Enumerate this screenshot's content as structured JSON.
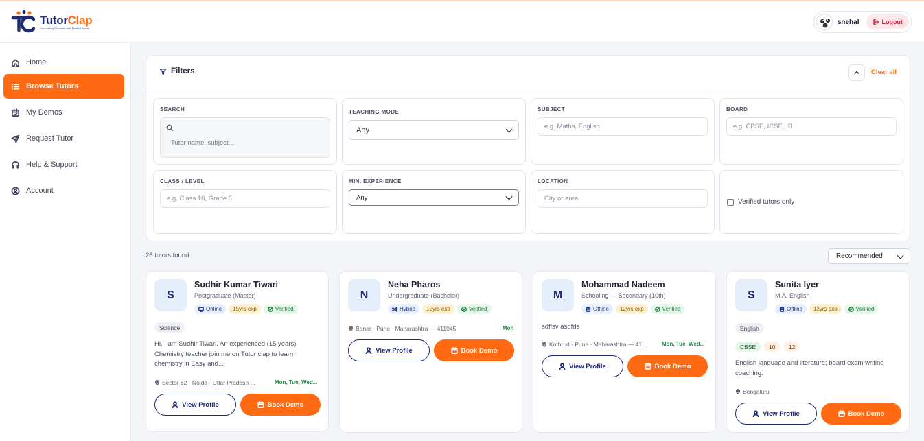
{
  "app": {
    "logo_primary": "Tutor",
    "logo_accent": "Clap",
    "tagline": "Connecting Students with Trusted Tutors"
  },
  "user": {
    "name": "snehal",
    "logout_label": "Logout"
  },
  "nav": [
    {
      "label": "Home",
      "icon": "home-icon"
    },
    {
      "label": "Browse Tutors",
      "icon": "list-icon"
    },
    {
      "label": "My Demos",
      "icon": "calendar-check-icon"
    },
    {
      "label": "Request Tutor",
      "icon": "send-icon"
    },
    {
      "label": "Help & Support",
      "icon": "headset-icon"
    },
    {
      "label": "Account",
      "icon": "user-circle-icon"
    }
  ],
  "filters": {
    "title": "Filters",
    "clear_all": "Clear all",
    "search": {
      "label": "SEARCH",
      "placeholder": "Tutor name, subject..."
    },
    "teaching_mode": {
      "label": "TEACHING MODE",
      "value": "Any"
    },
    "subject": {
      "label": "SUBJECT",
      "placeholder": "e.g. Maths, English"
    },
    "board": {
      "label": "BOARD",
      "placeholder": "e.g. CBSE, ICSE, IB"
    },
    "class_level": {
      "label": "CLASS / LEVEL",
      "placeholder": "e.g. Class 10, Grade 5"
    },
    "min_experience": {
      "label": "MIN. EXPERIENCE",
      "value": "Any"
    },
    "location": {
      "label": "LOCATION",
      "placeholder": "City or area"
    },
    "verified_only": {
      "label": "Verified tutors only",
      "checked": false
    }
  },
  "results": {
    "count_text": "26 tutors found",
    "sort": "Recommended"
  },
  "tutors": [
    {
      "initial": "S",
      "name": "Sudhir Kumar Tiwari",
      "education": "Postgraduate (Master)",
      "mode": "Online",
      "experience": "15yrs exp",
      "verified": "Verified",
      "subjects": [
        "Science"
      ],
      "chips": [],
      "description": "Hi, I am Sudhir Tiwari. An experienced (15 years) Chemistry teacher join me on Tutor clap to learn chemistry in Easy and...",
      "location": "Sector 62 · Noida · Uttar Pradesh ...",
      "days": "Mon, Tue, Wed...",
      "view_label": "View Profile",
      "book_label": "Book Demo"
    },
    {
      "initial": "N",
      "name": "Neha Pharos",
      "education": "Undergraduate (Bachelor)",
      "mode": "Hybrid",
      "experience": "12yrs exp",
      "verified": "Verified",
      "subjects": [],
      "chips": [],
      "description": "",
      "location": "Baner · Pune · Maharashtra — 411045",
      "days": "Mon",
      "view_label": "View Profile",
      "book_label": "Book Demo"
    },
    {
      "initial": "M",
      "name": "Mohammad Nadeem",
      "education": "Schooling — Secondary (10th)",
      "mode": "Offline",
      "experience": "12yrs exp",
      "verified": "Verified",
      "subjects": [],
      "chips": [],
      "description": "sdffsv asdfds",
      "location": "Kothrud · Pune · Maharashtra — 41...",
      "days": "Mon, Tue, Wed...",
      "view_label": "View Profile",
      "book_label": "Book Demo"
    },
    {
      "initial": "S",
      "name": "Sunita Iyer",
      "education": "M.A. English",
      "mode": "Offline",
      "experience": "12yrs exp",
      "verified": "Verified",
      "subjects": [
        "English"
      ],
      "chips": [
        "CBSE",
        "10",
        "12"
      ],
      "description": "English language and literature; board exam writing coaching.",
      "location": "Bengaluru",
      "days": "",
      "view_label": "View Profile",
      "book_label": "Book Demo"
    }
  ]
}
